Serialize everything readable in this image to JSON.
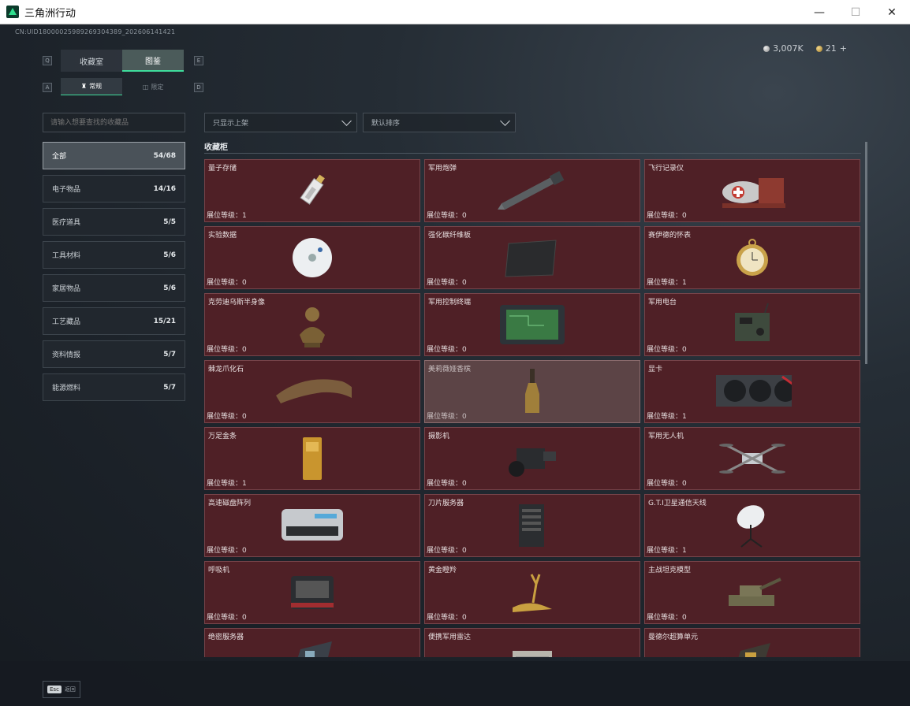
{
  "window": {
    "title": "三角洲行动",
    "minimize": "—",
    "maximize": "☐",
    "close": "✕"
  },
  "uid": "CN:UID18000025989269304389_202606141421",
  "currency": [
    {
      "name": "silver-coin",
      "value": "3,007K"
    },
    {
      "name": "gold-coin",
      "value": "21",
      "suffix": "+"
    }
  ],
  "hint_keys": {
    "q": "Q",
    "e": "E",
    "a": "A",
    "d": "D"
  },
  "main_tabs": [
    {
      "label": "收藏室",
      "active": false
    },
    {
      "label": "图鉴",
      "active": true
    }
  ],
  "sub_tabs": [
    {
      "label": "常规",
      "active": true
    },
    {
      "label": "限定",
      "active": false
    }
  ],
  "search": {
    "placeholder": "请输入想要查找的收藏品"
  },
  "filters": {
    "shelf": "只显示上架",
    "sort": "默认排序"
  },
  "categories": [
    {
      "label": "全部",
      "count": "54/68",
      "active": true
    },
    {
      "label": "电子物品",
      "count": "14/16"
    },
    {
      "label": "医疗道具",
      "count": "5/5"
    },
    {
      "label": "工具材料",
      "count": "5/6"
    },
    {
      "label": "家居物品",
      "count": "5/6"
    },
    {
      "label": "工艺藏品",
      "count": "15/21"
    },
    {
      "label": "资料情报",
      "count": "5/7"
    },
    {
      "label": "能源燃料",
      "count": "5/7"
    }
  ],
  "cabinet": {
    "title": "收藏柜",
    "items": [
      {
        "name": "量子存储",
        "level": "展位等级：1",
        "icon": "usb-drive-icon"
      },
      {
        "name": "军用炮弹",
        "level": "展位等级：0",
        "icon": "artillery-shell-icon"
      },
      {
        "name": "飞行记录仪",
        "level": "展位等级：0",
        "icon": "flight-recorder-icon"
      },
      {
        "name": "实验数据",
        "level": "展位等级：0",
        "icon": "disc-icon"
      },
      {
        "name": "强化碳纤维板",
        "level": "展位等级：0",
        "icon": "carbon-plate-icon"
      },
      {
        "name": "赛伊德的怀表",
        "level": "展位等级：1",
        "icon": "pocket-watch-icon"
      },
      {
        "name": "克劳迪乌斯半身像",
        "level": "展位等级：0",
        "icon": "bust-icon"
      },
      {
        "name": "军用控制终端",
        "level": "展位等级：0",
        "icon": "terminal-icon"
      },
      {
        "name": "军用电台",
        "level": "展位等级：0",
        "icon": "radio-icon"
      },
      {
        "name": "棘龙爪化石",
        "level": "展位等级：0",
        "icon": "claw-fossil-icon"
      },
      {
        "name": "美莉薇娅香槟",
        "level": "展位等级：0",
        "icon": "champagne-icon",
        "highlight": true
      },
      {
        "name": "显卡",
        "level": "展位等级：1",
        "icon": "gpu-icon"
      },
      {
        "name": "万足金条",
        "level": "展位等级：1",
        "icon": "gold-bar-icon"
      },
      {
        "name": "摄影机",
        "level": "展位等级：0",
        "icon": "camera-icon"
      },
      {
        "name": "军用无人机",
        "level": "展位等级：0",
        "icon": "drone-icon"
      },
      {
        "name": "高速磁盘阵列",
        "level": "展位等级：0",
        "icon": "disk-array-icon"
      },
      {
        "name": "刀片服务器",
        "level": "展位等级：0",
        "icon": "blade-server-icon"
      },
      {
        "name": "G.T.I卫星通信天线",
        "level": "展位等级：1",
        "icon": "satellite-dish-icon"
      },
      {
        "name": "呼吸机",
        "level": "展位等级：0",
        "icon": "ventilator-icon"
      },
      {
        "name": "黄金瞪羚",
        "level": "展位等级：0",
        "icon": "gazelle-icon"
      },
      {
        "name": "主战坦克模型",
        "level": "展位等级：0",
        "icon": "tank-icon"
      },
      {
        "name": "绝密服务器",
        "level": "",
        "icon": "server-board-icon"
      },
      {
        "name": "便携军用雷达",
        "level": "",
        "icon": "radar-icon"
      },
      {
        "name": "曼德尔超算单元",
        "level": "",
        "icon": "compute-unit-icon"
      }
    ]
  },
  "footer": {
    "esc_key": "Esc",
    "esc_label": "返回"
  }
}
